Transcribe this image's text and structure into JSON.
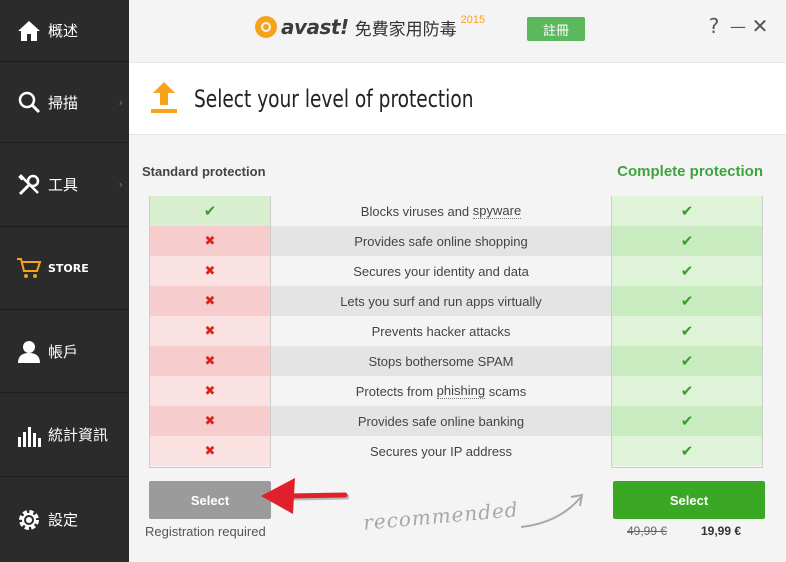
{
  "app": {
    "brand": "avast!",
    "product_title": "免費家用防毒",
    "year": "2015",
    "register_label": "註冊",
    "help_label": "?",
    "minimize_label": "—",
    "close_label": "✕",
    "brand_color": "#f7a21b"
  },
  "sidebar": {
    "items": [
      {
        "label": "概述",
        "icon": "home-icon"
      },
      {
        "label": "掃描",
        "icon": "magnifier-icon",
        "chevron": "›"
      },
      {
        "label": "工具",
        "icon": "tools-icon",
        "chevron": "›"
      },
      {
        "label": "STORE",
        "icon": "cart-icon"
      },
      {
        "label": "帳戶",
        "icon": "user-icon"
      },
      {
        "label": "統計資訊",
        "icon": "stats-icon"
      },
      {
        "label": "設定",
        "icon": "gear-icon"
      }
    ]
  },
  "header": {
    "title": "Select your level of protection",
    "icon": "upload-arrow-icon"
  },
  "comparison": {
    "standard_heading": "Standard protection",
    "complete_heading": "Complete protection",
    "features": [
      {
        "label_pre": "Blocks viruses and ",
        "label_link": "spyware",
        "label_post": "",
        "standard": true,
        "complete": true
      },
      {
        "label_pre": "Provides safe online shopping",
        "label_link": "",
        "label_post": "",
        "standard": false,
        "complete": true
      },
      {
        "label_pre": "Secures your identity and data",
        "label_link": "",
        "label_post": "",
        "standard": false,
        "complete": true
      },
      {
        "label_pre": "Lets you surf and run apps virtually",
        "label_link": "",
        "label_post": "",
        "standard": false,
        "complete": true
      },
      {
        "label_pre": "Prevents hacker attacks",
        "label_link": "",
        "label_post": "",
        "standard": false,
        "complete": true
      },
      {
        "label_pre": "Stops bothersome SPAM",
        "label_link": "",
        "label_post": "",
        "standard": false,
        "complete": true
      },
      {
        "label_pre": "Protects from ",
        "label_link": "phishing",
        "label_post": " scams",
        "standard": false,
        "complete": true
      },
      {
        "label_pre": "Provides safe online banking",
        "label_link": "",
        "label_post": "",
        "standard": false,
        "complete": true
      },
      {
        "label_pre": "Secures your IP address",
        "label_link": "",
        "label_post": "",
        "standard": false,
        "complete": true
      }
    ],
    "check_glyph": "✔",
    "cross_glyph": "✖",
    "standard_select_label": "Select",
    "complete_select_label": "Select",
    "registration_note": "Registration required",
    "old_price": "49,99 €",
    "new_price": "19,99 €",
    "recommended_label": "recommended"
  },
  "colors": {
    "accent_green": "#3aa824",
    "check_green": "#3b9d2a",
    "cross_red": "#d9261c",
    "annotation_red": "#e0202a"
  }
}
